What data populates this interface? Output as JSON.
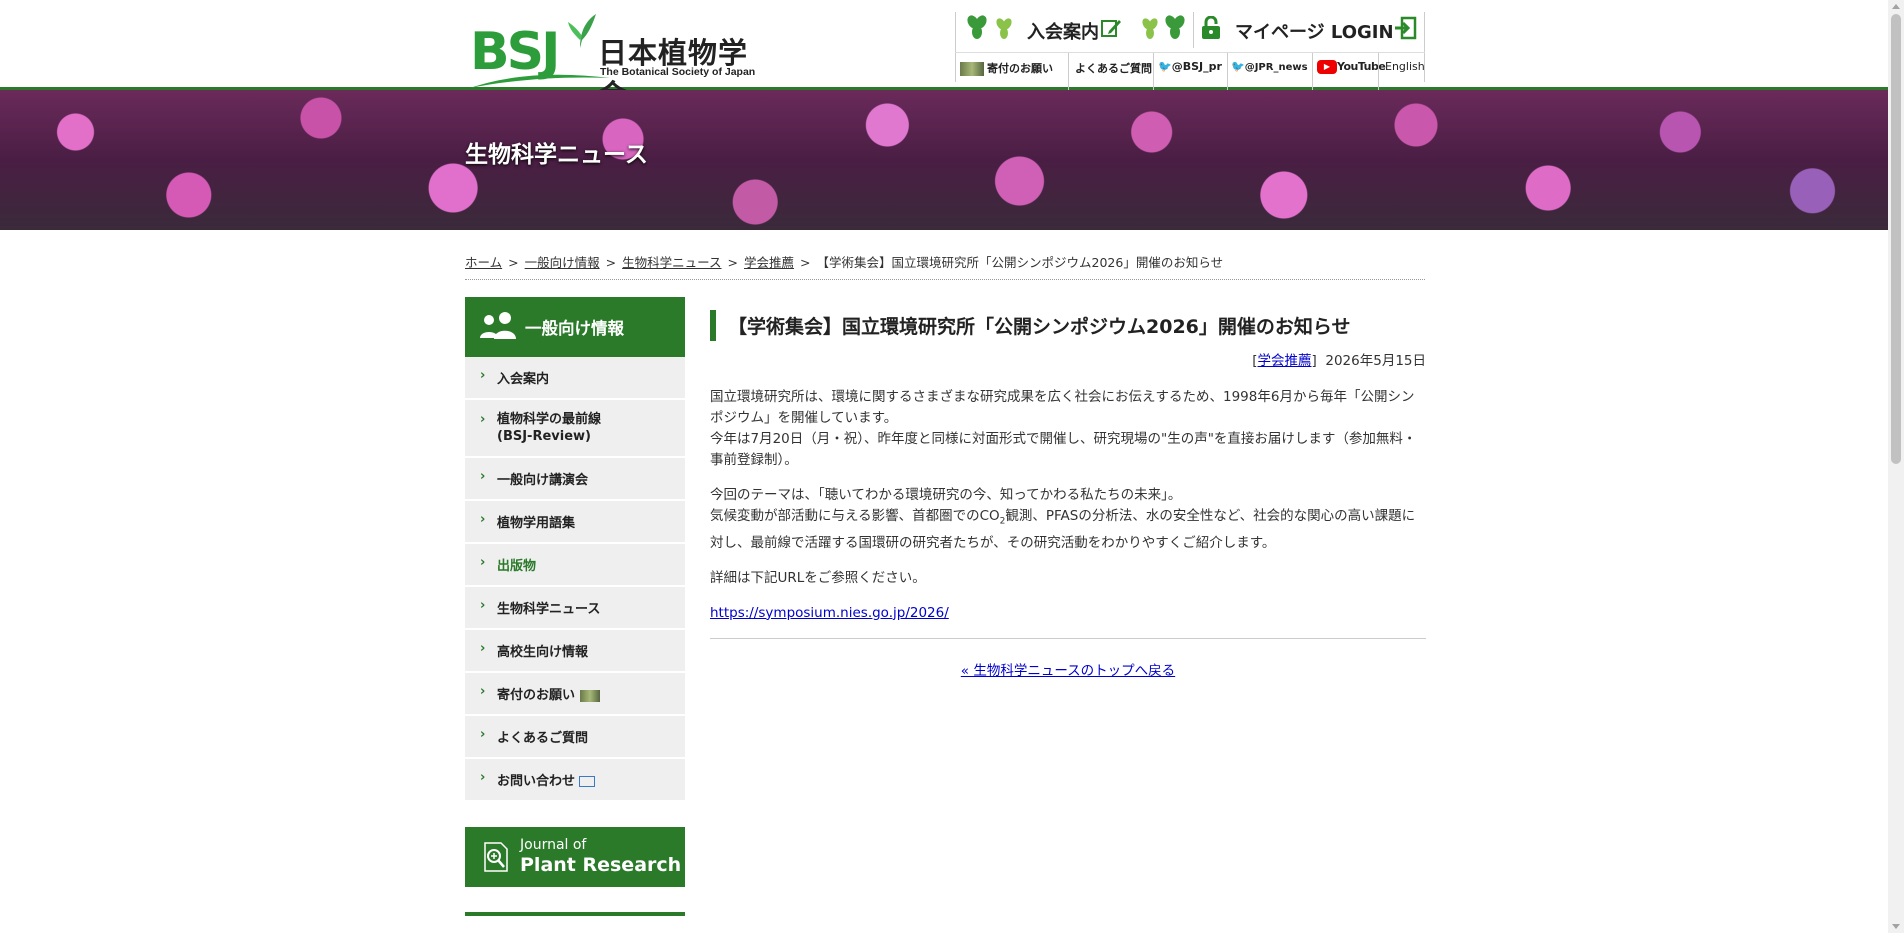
{
  "logo": {
    "mark": "BSJ",
    "name_jp": "日本植物学会",
    "name_en": "The Botanical Society of Japan"
  },
  "topnav": {
    "join_label": "入会案内",
    "mypage_label": "マイページ LOGIN",
    "donate_label": "寄付のお願い",
    "faq_label": "よくあるご質問",
    "twitter1": "@BSJ_pr",
    "twitter2": "@JPR_news",
    "youtube": "YouTube",
    "english": "English"
  },
  "hero": {
    "title": "生物科学ニュース"
  },
  "breadcrumb": {
    "items": [
      "ホーム",
      "一般向け情報",
      "生物科学ニュース",
      "学会推薦"
    ],
    "separator": ">",
    "current": "【学術集会】国立環境研究所「公開シンポジウム2026」開催のお知らせ"
  },
  "sidebar": {
    "heading": "一般向け情報",
    "items": [
      {
        "label": "入会案内"
      },
      {
        "label": "植物科学の最前線",
        "sub": "(BSJ-Review)"
      },
      {
        "label": "一般向け講演会"
      },
      {
        "label": "植物学用語集"
      },
      {
        "label": "出版物"
      },
      {
        "label": "生物科学ニュース"
      },
      {
        "label": "高校生向け情報"
      },
      {
        "label": "寄付のお願い"
      },
      {
        "label": "よくあるご質問"
      },
      {
        "label": "お問い合わせ"
      }
    ],
    "banner": {
      "line1": "Journal of",
      "line2": "Plant Research"
    }
  },
  "article": {
    "title": "【学術集会】国立環境研究所「公開シンポジウム2026」開催のお知らせ",
    "category": "学会推薦",
    "date": "2026年5月15日",
    "p1": "国立環境研究所は、環境に関するさまざまな研究成果を広く社会にお伝えするため、1998年6月から毎年「公開シンポジウム」を開催しています。",
    "p1b": "今年は7月20日（月・祝）、昨年度と同様に対面形式で開催し、研究現場の\"生の声\"を直接お届けします（参加無料・事前登録制）。",
    "p2": "今回のテーマは、「聴いてわかる環境研究の今、知ってかわる私たちの未来」。",
    "p2b_pre": "気候変動が部活動に与える影響、首都圏でのCO",
    "p2b_sub": "2",
    "p2b_post": "観測、PFASの分析法、水の安全性など、社会的な関心の高い課題に対し、最前線で活躍する国環研の研究者たちが、その研究活動をわかりやすくご紹介します。",
    "p3": "詳細は下記URLをご参照ください。",
    "url": "https://symposium.nies.go.jp/2026/",
    "back_link": "« 生物科学ニュースのトップへ戻る"
  },
  "colors": {
    "brand_green": "#2a7a2a",
    "logo_green": "#2d9c3a"
  }
}
